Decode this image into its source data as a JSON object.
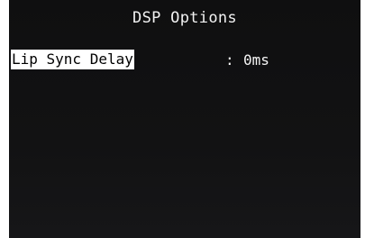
{
  "screen": {
    "title": "DSP Options"
  },
  "menu": {
    "items": [
      {
        "label": "Lip Sync Delay",
        "separator": ":",
        "value": "0ms",
        "selected": true
      }
    ]
  },
  "colors": {
    "background": "#121213",
    "text": "#ffffff",
    "highlight_bg": "#ffffff",
    "highlight_text": "#000000"
  }
}
